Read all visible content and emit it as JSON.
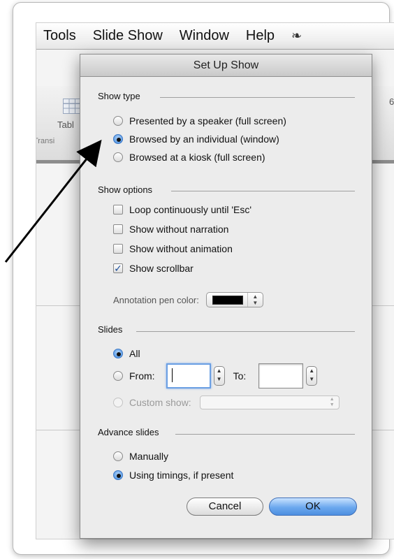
{
  "menubar": {
    "items": [
      "Tools",
      "Slide Show",
      "Window",
      "Help"
    ],
    "script_icon": "script-menu-icon"
  },
  "background": {
    "ribbon_left_text": "Tabl",
    "ribbon_left_small": "Transi",
    "ribbon_right_text": "6"
  },
  "dialog": {
    "title": "Set Up Show",
    "show_type": {
      "label": "Show type",
      "options": [
        {
          "label": "Presented by a speaker (full screen)",
          "selected": false
        },
        {
          "label": "Browsed by an individual (window)",
          "selected": true
        },
        {
          "label": "Browsed at a kiosk (full screen)",
          "selected": false
        }
      ]
    },
    "show_options": {
      "label": "Show options",
      "checkboxes": [
        {
          "label": "Loop continuously until 'Esc'",
          "checked": false
        },
        {
          "label": "Show without narration",
          "checked": false
        },
        {
          "label": "Show without animation",
          "checked": false
        },
        {
          "label": "Show scrollbar",
          "checked": true
        }
      ],
      "annotation_label": "Annotation pen color:",
      "annotation_color": "#000000"
    },
    "slides": {
      "label": "Slides",
      "all_label": "All",
      "from_label": "From:",
      "from_value": "",
      "to_label": "To:",
      "to_value": "",
      "custom_label": "Custom show:",
      "custom_value": "",
      "selected": "All"
    },
    "advance": {
      "label": "Advance slides",
      "options": [
        {
          "label": "Manually",
          "selected": false
        },
        {
          "label": "Using timings, if present",
          "selected": true
        }
      ]
    },
    "buttons": {
      "cancel": "Cancel",
      "ok": "OK"
    }
  },
  "colors": {
    "accent": "#5d9de6",
    "annotation_arrow": "#000000"
  }
}
